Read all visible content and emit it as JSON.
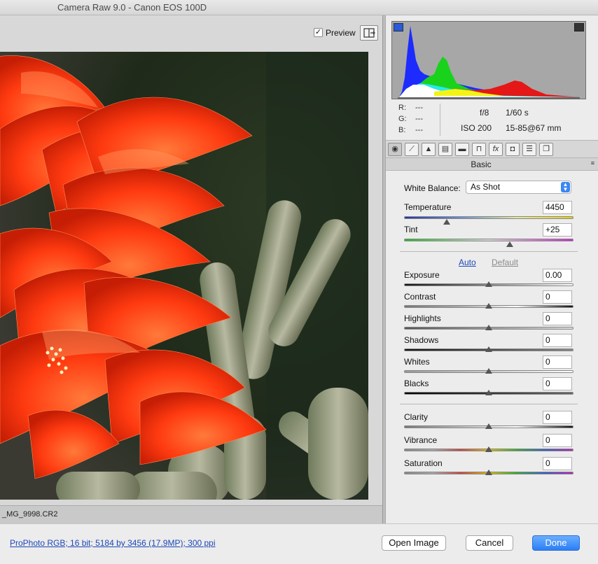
{
  "window": {
    "title": "Camera Raw 9.0  -  Canon EOS 100D"
  },
  "preview": {
    "label": "Preview",
    "checked": "✓"
  },
  "file": {
    "name": "_MG_9998.CR2"
  },
  "readout": {
    "r_label": "R:",
    "g_label": "G:",
    "b_label": "B:",
    "r_value": "---",
    "g_value": "---",
    "b_value": "---",
    "aperture": "f/8",
    "shutter": "1/60 s",
    "iso": "ISO 200",
    "lens": "15-85@67 mm"
  },
  "tabs": [
    {
      "icon": "aperture-icon",
      "glyph": "◉"
    },
    {
      "icon": "tone-curve-icon",
      "glyph": "⟋"
    },
    {
      "icon": "detail-icon",
      "glyph": "▲"
    },
    {
      "icon": "hsl-icon",
      "glyph": "▤"
    },
    {
      "icon": "split-toning-icon",
      "glyph": "▬"
    },
    {
      "icon": "lens-corrections-icon",
      "glyph": "⊓"
    },
    {
      "icon": "effects-icon",
      "glyph": "fx"
    },
    {
      "icon": "camera-calibration-icon",
      "glyph": "◘"
    },
    {
      "icon": "presets-icon",
      "glyph": "☰"
    },
    {
      "icon": "snapshots-icon",
      "glyph": "❐"
    }
  ],
  "panel": {
    "title": "Basic",
    "menu_glyph": "≡"
  },
  "white_balance": {
    "label": "White Balance:",
    "value": "As Shot"
  },
  "temperature": {
    "label": "Temperature",
    "value": "4450",
    "level": 0.25
  },
  "tint": {
    "label": "Tint",
    "value": "+25",
    "level": 0.625
  },
  "auto_label": "Auto",
  "default_label": "Default",
  "sliders": [
    {
      "label": "Exposure",
      "value": "0.00",
      "level": 0.5
    },
    {
      "label": "Contrast",
      "value": "0",
      "level": 0.5
    },
    {
      "label": "Highlights",
      "value": "0",
      "level": 0.5
    },
    {
      "label": "Shadows",
      "value": "0",
      "level": 0.5
    },
    {
      "label": "Whites",
      "value": "0",
      "level": 0.5
    },
    {
      "label": "Blacks",
      "value": "0",
      "level": 0.5
    }
  ],
  "presence": [
    {
      "label": "Clarity",
      "value": "0",
      "level": 0.5
    },
    {
      "label": "Vibrance",
      "value": "0",
      "level": 0.5
    },
    {
      "label": "Saturation",
      "value": "0",
      "level": 0.5
    }
  ],
  "bottom": {
    "workflow_link": "ProPhoto RGB; 16 bit; 5184 by 3456 (17.9MP); 300 ppi",
    "open_image": "Open Image",
    "cancel": "Cancel",
    "done": "Done"
  },
  "colors": {
    "accent": "#2b7ef6",
    "link": "#1d47b8"
  }
}
